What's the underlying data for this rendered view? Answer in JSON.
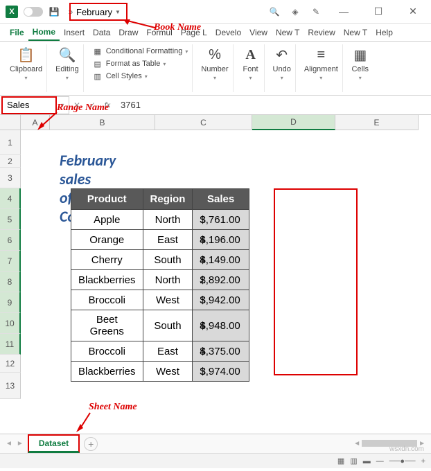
{
  "titlebar": {
    "autosave_label": "",
    "book_name": "February",
    "search_placeholder": "Search"
  },
  "annotations": {
    "book_name": "Book Name",
    "range_name": "Range Name",
    "sheet_name": "Sheet Name"
  },
  "menu": {
    "file": "File",
    "home": "Home",
    "insert": "Insert",
    "data": "Data",
    "draw": "Draw",
    "formulas": "Formul",
    "page": "Page L",
    "developer": "Develo",
    "view": "View",
    "newt1": "New T",
    "review": "Review",
    "newt2": "New T",
    "help": "Help"
  },
  "ribbon": {
    "clipboard": "Clipboard",
    "editing": "Editing",
    "cond_format": "Conditional Formatting",
    "format_table": "Format as Table",
    "cell_styles": "Cell Styles",
    "number": "Number",
    "font": "Font",
    "undo": "Undo",
    "alignment": "Alignment",
    "cells": "Cells"
  },
  "formula_bar": {
    "name_box": "Sales",
    "formula": "3761"
  },
  "columns": [
    "A",
    "B",
    "C",
    "D",
    "E"
  ],
  "rows": [
    "1",
    "2",
    "3",
    "4",
    "5",
    "6",
    "7",
    "8",
    "9",
    "10",
    "11",
    "12",
    "13"
  ],
  "sheet": {
    "title": "February sales of\"XYZ\" Company",
    "headers": {
      "product": "Product",
      "region": "Region",
      "sales": "Sales"
    },
    "data": [
      {
        "product": "Apple",
        "region": "North",
        "sales": "3,761.00"
      },
      {
        "product": "Orange",
        "region": "East",
        "sales": "4,196.00"
      },
      {
        "product": "Cherry",
        "region": "South",
        "sales": "4,149.00"
      },
      {
        "product": "Blackberries",
        "region": "North",
        "sales": "2,892.00"
      },
      {
        "product": "Broccoli",
        "region": "West",
        "sales": "3,942.00"
      },
      {
        "product": "Beet Greens",
        "region": "South",
        "sales": "4,948.00"
      },
      {
        "product": "Broccoli",
        "region": "East",
        "sales": "4,375.00"
      },
      {
        "product": "Blackberries",
        "region": "West",
        "sales": "3,974.00"
      }
    ]
  },
  "sheet_tab": "Dataset",
  "watermark": "wsxdn.com",
  "chart_data": {
    "type": "table",
    "title": "February sales of \"XYZ\" Company",
    "columns": [
      "Product",
      "Region",
      "Sales"
    ],
    "rows": [
      [
        "Apple",
        "North",
        3761.0
      ],
      [
        "Orange",
        "East",
        4196.0
      ],
      [
        "Cherry",
        "South",
        4149.0
      ],
      [
        "Blackberries",
        "North",
        2892.0
      ],
      [
        "Broccoli",
        "West",
        3942.0
      ],
      [
        "Beet Greens",
        "South",
        4948.0
      ],
      [
        "Broccoli",
        "East",
        4375.0
      ],
      [
        "Blackberries",
        "West",
        3974.0
      ]
    ]
  }
}
